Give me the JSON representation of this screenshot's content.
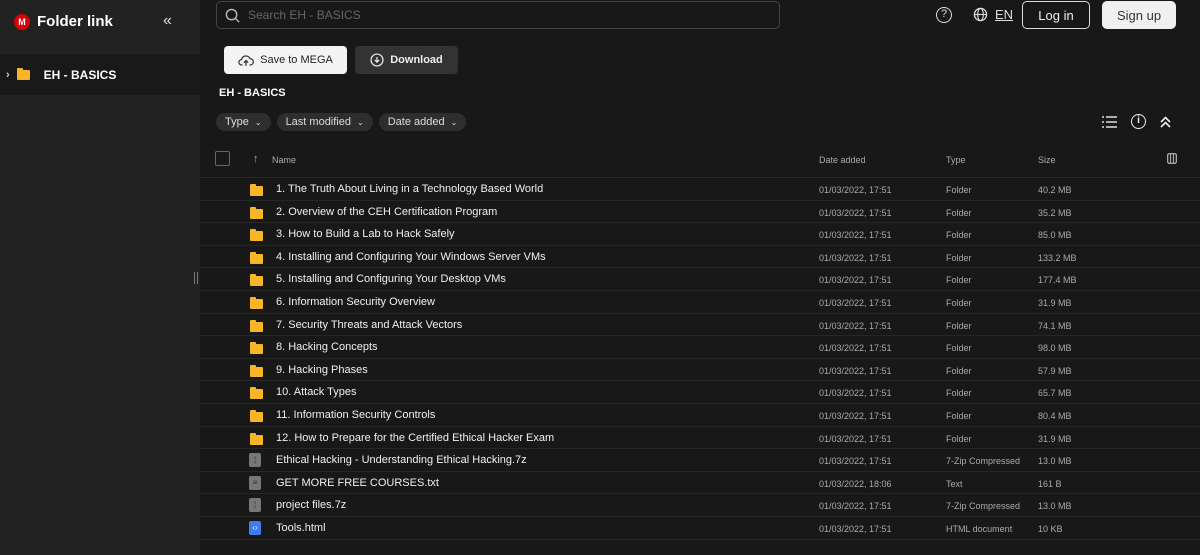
{
  "sidebar": {
    "title": "Folder link",
    "logo_letter": "M",
    "item": "EH - BASICS"
  },
  "header": {
    "search_placeholder": "Search EH - BASICS",
    "lang": "EN",
    "login": "Log in",
    "signup": "Sign up"
  },
  "actions": {
    "save": "Save to MEGA",
    "download": "Download"
  },
  "breadcrumb": "EH - BASICS",
  "filters": [
    "Type",
    "Last modified",
    "Date added"
  ],
  "columns": {
    "name": "Name",
    "date": "Date added",
    "type": "Type",
    "size": "Size"
  },
  "rows": [
    {
      "name": "1. The Truth About Living in a Technology Based World",
      "date": "01/03/2022, 17:51",
      "type": "Folder",
      "size": "40.2 MB",
      "icon": "folder"
    },
    {
      "name": "2. Overview of the CEH Certification Program",
      "date": "01/03/2022, 17:51",
      "type": "Folder",
      "size": "35.2 MB",
      "icon": "folder"
    },
    {
      "name": "3. How to Build a Lab to Hack Safely",
      "date": "01/03/2022, 17:51",
      "type": "Folder",
      "size": "85.0 MB",
      "icon": "folder"
    },
    {
      "name": "4. Installing and Configuring Your Windows Server VMs",
      "date": "01/03/2022, 17:51",
      "type": "Folder",
      "size": "133.2 MB",
      "icon": "folder"
    },
    {
      "name": "5. Installing and Configuring Your Desktop VMs",
      "date": "01/03/2022, 17:51",
      "type": "Folder",
      "size": "177.4 MB",
      "icon": "folder"
    },
    {
      "name": "6. Information Security Overview",
      "date": "01/03/2022, 17:51",
      "type": "Folder",
      "size": "31.9 MB",
      "icon": "folder"
    },
    {
      "name": "7. Security Threats and Attack Vectors",
      "date": "01/03/2022, 17:51",
      "type": "Folder",
      "size": "74.1 MB",
      "icon": "folder"
    },
    {
      "name": "8. Hacking Concepts",
      "date": "01/03/2022, 17:51",
      "type": "Folder",
      "size": "98.0 MB",
      "icon": "folder"
    },
    {
      "name": "9. Hacking Phases",
      "date": "01/03/2022, 17:51",
      "type": "Folder",
      "size": "57.9 MB",
      "icon": "folder"
    },
    {
      "name": "10. Attack Types",
      "date": "01/03/2022, 17:51",
      "type": "Folder",
      "size": "65.7 MB",
      "icon": "folder"
    },
    {
      "name": "11. Information Security Controls",
      "date": "01/03/2022, 17:51",
      "type": "Folder",
      "size": "80.4 MB",
      "icon": "folder"
    },
    {
      "name": "12. How to Prepare for the Certified Ethical Hacker Exam",
      "date": "01/03/2022, 17:51",
      "type": "Folder",
      "size": "31.9 MB",
      "icon": "folder"
    },
    {
      "name": "Ethical Hacking - Understanding Ethical Hacking.7z",
      "date": "01/03/2022, 17:51",
      "type": "7-Zip Compressed",
      "size": "13.0 MB",
      "icon": "archive"
    },
    {
      "name": "GET MORE FREE COURSES.txt",
      "date": "01/03/2022, 18:06",
      "type": "Text",
      "size": "161 B",
      "icon": "text"
    },
    {
      "name": "project files.7z",
      "date": "01/03/2022, 17:51",
      "type": "7-Zip Compressed",
      "size": "13.0 MB",
      "icon": "archive"
    },
    {
      "name": "Tools.html",
      "date": "01/03/2022, 17:51",
      "type": "HTML document",
      "size": "10 KB",
      "icon": "html"
    }
  ]
}
